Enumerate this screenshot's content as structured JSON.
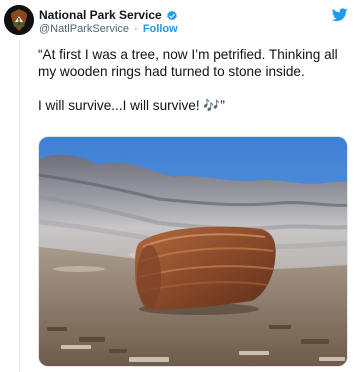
{
  "tweet": {
    "author": {
      "display_name": "National Park Service",
      "handle": "@NatlParkService",
      "separator": "·",
      "follow_label": "Follow",
      "verified": true
    },
    "text_line1": "“At first I was a tree, now I’m petrified. Thinking all my wooden rings had turned to stone inside.",
    "text_line2": "I will survive...I will survive! 🎶”",
    "brand_icon": "twitter-bird-icon"
  },
  "colors": {
    "accent": "#1d9bf0",
    "text": "#0f1419",
    "muted": "#536471"
  }
}
